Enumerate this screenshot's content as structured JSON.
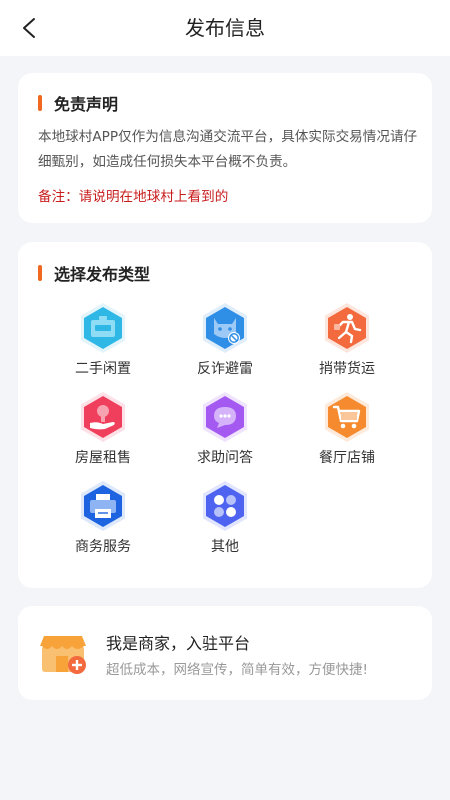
{
  "header": {
    "title": "发布信息"
  },
  "disclaimer": {
    "title": "免责声明",
    "body": "本地球村APP仅作为信息沟通交流平台，具体实际交易情况请仔细甄别，如造成任何损失本平台概不负责。",
    "note": "备注：请说明在地球村上看到的"
  },
  "types": {
    "title": "选择发布类型",
    "items": [
      {
        "label": "二手闲置",
        "icon": "secondhand-icon",
        "color": "#2fb8e6"
      },
      {
        "label": "反诈避雷",
        "icon": "anti-fraud-icon",
        "color": "#2f8fe6"
      },
      {
        "label": "捎带货运",
        "icon": "delivery-runner-icon",
        "color": "#f26a3d"
      },
      {
        "label": "房屋租售",
        "icon": "house-hand-icon",
        "color": "#ef3f5c"
      },
      {
        "label": "求助问答",
        "icon": "chat-bubble-icon",
        "color": "#a45af0"
      },
      {
        "label": "餐厅店铺",
        "icon": "shopping-cart-icon",
        "color": "#f58a2e"
      },
      {
        "label": "商务服务",
        "icon": "printer-icon",
        "color": "#1e63e0"
      },
      {
        "label": "其他",
        "icon": "four-petal-icon",
        "color": "#4e63f0"
      }
    ]
  },
  "merchant": {
    "title": "我是商家，入驻平台",
    "subtitle": "超低成本，网络宣传，简单有效，方便快捷!",
    "icon": "storefront-plus-icon",
    "color": "#f7a33a"
  }
}
